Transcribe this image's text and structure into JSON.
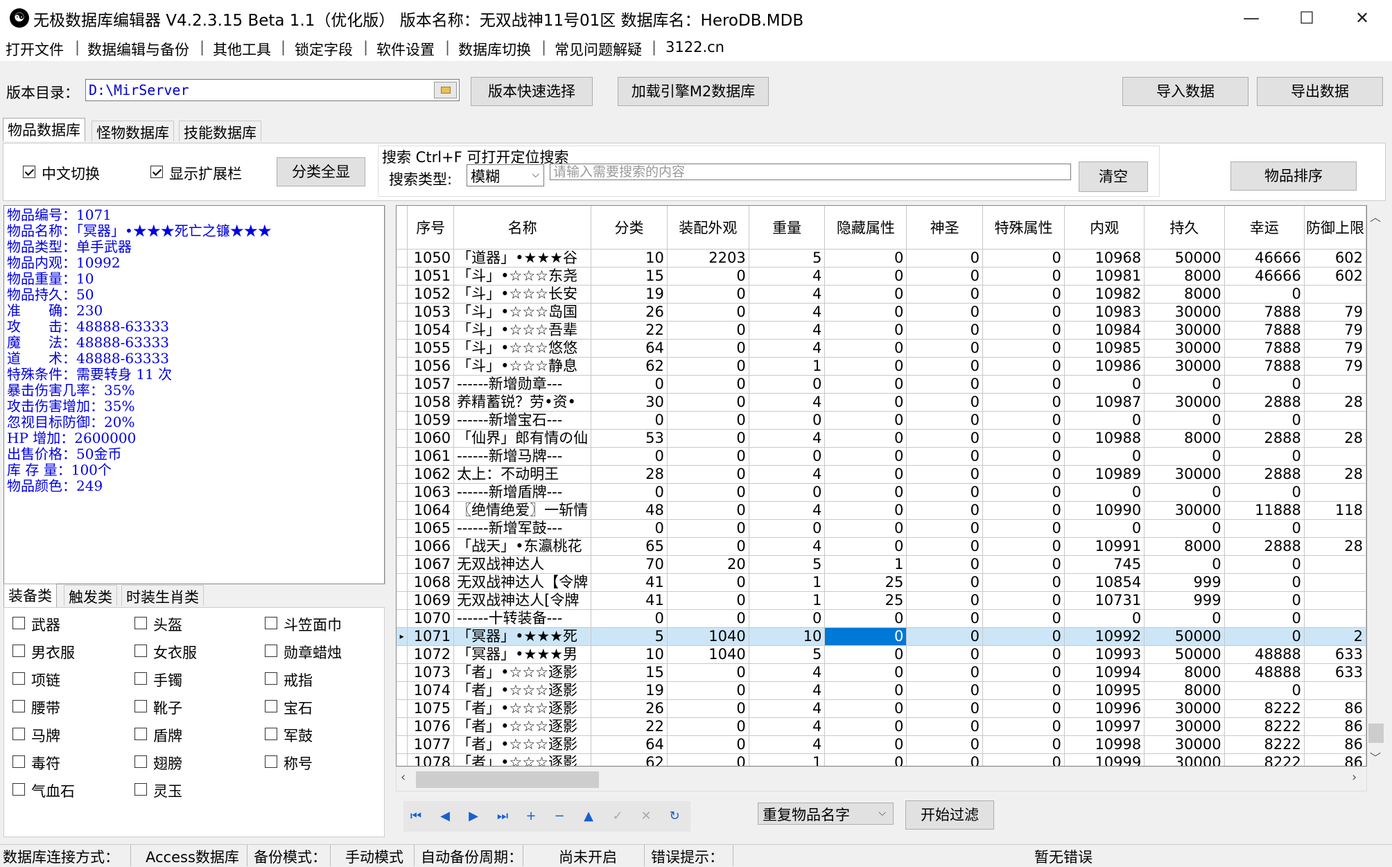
{
  "window": {
    "title": "无极数据库编辑器 V4.2.3.15    Beta 1.1（优化版）    版本名称：无双战神11号01区    数据库名：HeroDB.MDB",
    "minimize": "—",
    "maximize": "☐",
    "close": "✕"
  },
  "menu": [
    "打开文件",
    "数据编辑与备份",
    "其他工具",
    "锁定字段",
    "软件设置",
    "数据库切换",
    "常见问题解疑",
    "3122.cn"
  ],
  "toolbar": {
    "dir_label": "版本目录：",
    "dir_value": "D:\\MirServer",
    "quick_select": "版本快速选择",
    "load_m2": "加载引擎M2数据库",
    "import": "导入数据",
    "export": "导出数据"
  },
  "main_tabs": [
    "物品数据库",
    "怪物数据库",
    "技能数据库"
  ],
  "options": {
    "chinese_toggle": "中文切换",
    "show_ext": "显示扩展栏",
    "show_all": "分类全显",
    "search_title": "搜索   Ctrl+F 可打开定位搜索",
    "search_type_label": "搜索类型:",
    "search_type_value": "模糊",
    "search_placeholder": "请输入需要搜索的内容",
    "clear": "清空",
    "sort": "物品排序"
  },
  "info": [
    "物品编号：1071",
    "物品名称：「冥器」•★★★死亡之镰★★★",
    "物品类型：单手武器",
    "物品内观：10992",
    "物品重量：10",
    "物品持久：50",
    "准　　确：230",
    "攻　　击：48888-63333",
    "魔　　法：48888-63333",
    "道　　术：48888-63333",
    "特殊条件：需要转身 11 次",
    "暴击伤害几率：35%",
    "攻击伤害增加：35%",
    "忽视目标防御：20%",
    "HP  增加：2600000",
    "出售价格：50金币",
    "库 存 量：100个",
    "物品颜色：249"
  ],
  "cat_tabs": [
    "装备类",
    "触发类",
    "时装生肖类"
  ],
  "categories": [
    [
      "武器",
      "头盔",
      "斗笠面巾"
    ],
    [
      "男衣服",
      "女衣服",
      "勋章蜡烛"
    ],
    [
      "项链",
      "手镯",
      "戒指"
    ],
    [
      "腰带",
      "靴子",
      "宝石"
    ],
    [
      "马牌",
      "盾牌",
      "军鼓"
    ],
    [
      "毒符",
      "翅膀",
      "称号"
    ],
    [
      "气血石",
      "灵玉",
      ""
    ]
  ],
  "table": {
    "columns": [
      "序号",
      "名称",
      "分类",
      "装配外观",
      "重量",
      "隐藏属性",
      "神圣",
      "特殊属性",
      "内观",
      "持久",
      "幸运",
      "防御上限"
    ],
    "rows": [
      [
        "1050",
        "「道器」•★★★谷",
        "10",
        "2203",
        "5",
        "0",
        "0",
        "0",
        "10968",
        "50000",
        "46666",
        "602"
      ],
      [
        "1051",
        "「斗」•☆☆☆东尧",
        "15",
        "0",
        "4",
        "0",
        "0",
        "0",
        "10981",
        "8000",
        "46666",
        "602"
      ],
      [
        "1052",
        "「斗」•☆☆☆长安",
        "19",
        "0",
        "4",
        "0",
        "0",
        "0",
        "10982",
        "8000",
        "0",
        ""
      ],
      [
        "1053",
        "「斗」•☆☆☆岛国",
        "26",
        "0",
        "4",
        "0",
        "0",
        "0",
        "10983",
        "30000",
        "7888",
        "79"
      ],
      [
        "1054",
        "「斗」•☆☆☆吾辈",
        "22",
        "0",
        "4",
        "0",
        "0",
        "0",
        "10984",
        "30000",
        "7888",
        "79"
      ],
      [
        "1055",
        "「斗」•☆☆☆悠悠",
        "64",
        "0",
        "4",
        "0",
        "0",
        "0",
        "10985",
        "30000",
        "7888",
        "79"
      ],
      [
        "1056",
        "「斗」•☆☆☆静息",
        "62",
        "0",
        "1",
        "0",
        "0",
        "0",
        "10986",
        "30000",
        "7888",
        "79"
      ],
      [
        "1057",
        "------新增勋章---",
        "0",
        "0",
        "0",
        "0",
        "0",
        "0",
        "0",
        "0",
        "0",
        ""
      ],
      [
        "1058",
        "养精蓄锐？劳•资•",
        "30",
        "0",
        "4",
        "0",
        "0",
        "0",
        "10987",
        "30000",
        "2888",
        "28"
      ],
      [
        "1059",
        "------新增宝石---",
        "0",
        "0",
        "0",
        "0",
        "0",
        "0",
        "0",
        "0",
        "0",
        ""
      ],
      [
        "1060",
        "「仙界」郎有情の仙",
        "53",
        "0",
        "4",
        "0",
        "0",
        "0",
        "10988",
        "8000",
        "2888",
        "28"
      ],
      [
        "1061",
        "------新增马牌---",
        "0",
        "0",
        "0",
        "0",
        "0",
        "0",
        "0",
        "0",
        "0",
        ""
      ],
      [
        "1062",
        "太上：不动明王",
        "28",
        "0",
        "4",
        "0",
        "0",
        "0",
        "10989",
        "30000",
        "2888",
        "28"
      ],
      [
        "1063",
        "------新增盾牌---",
        "0",
        "0",
        "0",
        "0",
        "0",
        "0",
        "0",
        "0",
        "0",
        ""
      ],
      [
        "1064",
        "〖绝情绝爱〗一斩情",
        "48",
        "0",
        "4",
        "0",
        "0",
        "0",
        "10990",
        "30000",
        "11888",
        "118"
      ],
      [
        "1065",
        "------新增军鼓---",
        "0",
        "0",
        "0",
        "0",
        "0",
        "0",
        "0",
        "0",
        "0",
        ""
      ],
      [
        "1066",
        "「战天」•东瀛桃花",
        "65",
        "0",
        "4",
        "0",
        "0",
        "0",
        "10991",
        "8000",
        "2888",
        "28"
      ],
      [
        "1067",
        "无双战神达人",
        "70",
        "20",
        "5",
        "1",
        "0",
        "0",
        "745",
        "0",
        "0",
        ""
      ],
      [
        "1068",
        "无双战神达人【令牌",
        "41",
        "0",
        "1",
        "25",
        "0",
        "0",
        "10854",
        "999",
        "0",
        ""
      ],
      [
        "1069",
        "无双战神达人[令牌",
        "41",
        "0",
        "1",
        "25",
        "0",
        "0",
        "10731",
        "999",
        "0",
        ""
      ],
      [
        "1070",
        "------十转装备---",
        "0",
        "0",
        "0",
        "0",
        "0",
        "0",
        "0",
        "0",
        "0",
        ""
      ],
      [
        "1071",
        "「冥器」•★★★死",
        "5",
        "1040",
        "10",
        "0",
        "0",
        "0",
        "10992",
        "50000",
        "0",
        "2"
      ],
      [
        "1072",
        "「冥器」•★★★男",
        "10",
        "1040",
        "5",
        "0",
        "0",
        "0",
        "10993",
        "50000",
        "48888",
        "633"
      ],
      [
        "1073",
        "「者」•☆☆☆逐影",
        "15",
        "0",
        "4",
        "0",
        "0",
        "0",
        "10994",
        "8000",
        "48888",
        "633"
      ],
      [
        "1074",
        "「者」•☆☆☆逐影",
        "19",
        "0",
        "4",
        "0",
        "0",
        "0",
        "10995",
        "8000",
        "0",
        ""
      ],
      [
        "1075",
        "「者」•☆☆☆逐影",
        "26",
        "0",
        "4",
        "0",
        "0",
        "0",
        "10996",
        "30000",
        "8222",
        "86"
      ],
      [
        "1076",
        "「者」•☆☆☆逐影",
        "22",
        "0",
        "4",
        "0",
        "0",
        "0",
        "10997",
        "30000",
        "8222",
        "86"
      ],
      [
        "1077",
        "「者」•☆☆☆逐影",
        "64",
        "0",
        "4",
        "0",
        "0",
        "0",
        "10998",
        "30000",
        "8222",
        "86"
      ],
      [
        "1078",
        "「者」•☆☆☆逐影",
        "62",
        "0",
        "1",
        "0",
        "0",
        "0",
        "10999",
        "30000",
        "8222",
        "86"
      ]
    ],
    "selected_row": "1071",
    "row_indicator": "▸"
  },
  "nav_icons": [
    "first-icon",
    "prior-icon",
    "next-icon",
    "last-icon",
    "insert-icon",
    "delete-icon",
    "edit-icon",
    "post-icon",
    "cancel-icon",
    "refresh-icon"
  ],
  "filter": {
    "select_value": "重复物品名字",
    "start": "开始过滤"
  },
  "status": {
    "conn_label": "数据库连接方式：",
    "conn_value": "Access数据库",
    "backup_label": "备份模式：",
    "backup_value": "手动模式",
    "auto_label": "自动备份周期：",
    "auto_value": "尚未开启",
    "error_label": "错误提示：",
    "error_value": "暂无错误"
  },
  "colors": {
    "info_text": "#0000e0",
    "selection": "#cde6f7",
    "focus_cell": "#0078d7",
    "nav_icon": "#1a5fd0"
  }
}
